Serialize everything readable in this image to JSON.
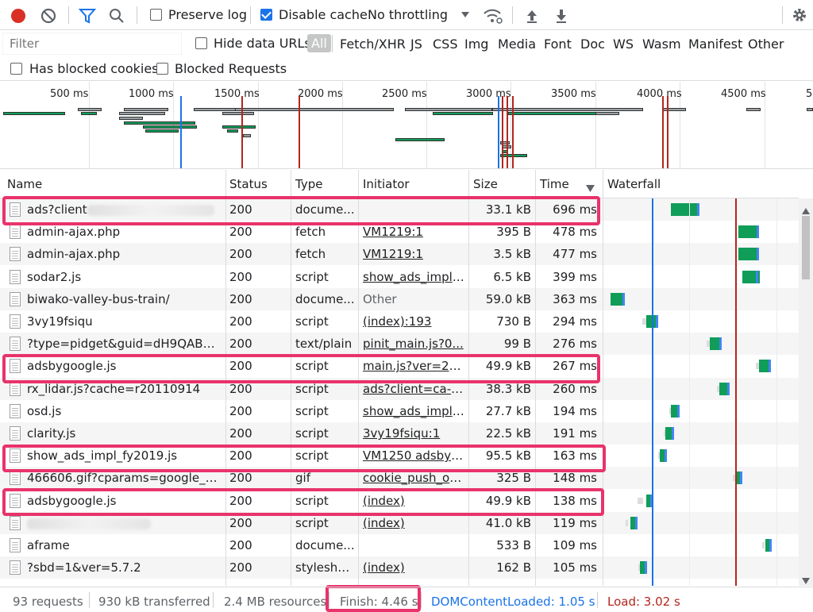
{
  "toolbar": {
    "preserve_log": "Preserve log",
    "disable_cache": "Disable cache",
    "throttling": "No throttling"
  },
  "filter": {
    "placeholder": "Filter",
    "hide_data_urls": "Hide data URLs",
    "types": [
      "All",
      "Fetch/XHR",
      "JS",
      "CSS",
      "Img",
      "Media",
      "Font",
      "Doc",
      "WS",
      "Wasm",
      "Manifest",
      "Other"
    ],
    "has_blocked_cookies": "Has blocked cookies",
    "blocked_requests": "Blocked Requests"
  },
  "overview": {
    "ticks": [
      "500 ms",
      "1000 ms",
      "1500 ms",
      "2000 ms",
      "2500 ms",
      "3000 ms",
      "3500 ms",
      "4000 ms",
      "4500 ms",
      "5"
    ]
  },
  "table": {
    "headers": {
      "name": "Name",
      "status": "Status",
      "type": "Type",
      "initiator": "Initiator",
      "size": "Size",
      "time": "Time",
      "waterfall": "Waterfall"
    },
    "rows": [
      {
        "name": "ads?client",
        "status": "200",
        "type": "docume...",
        "initiator": "",
        "size": "33.1 kB",
        "time": "696 ms"
      },
      {
        "name": "admin-ajax.php",
        "status": "200",
        "type": "fetch",
        "initiator": "VM1219:1",
        "size": "395 B",
        "time": "478 ms"
      },
      {
        "name": "admin-ajax.php",
        "status": "200",
        "type": "fetch",
        "initiator": "VM1219:1",
        "size": "3.5 kB",
        "time": "477 ms"
      },
      {
        "name": "sodar2.js",
        "status": "200",
        "type": "script",
        "initiator": "show_ads_impl_...",
        "size": "6.5 kB",
        "time": "399 ms"
      },
      {
        "name": "biwako-valley-bus-train/",
        "status": "200",
        "type": "docume...",
        "initiator": "Other",
        "size": "59.0 kB",
        "time": "363 ms"
      },
      {
        "name": "3vy19fsiqu",
        "status": "200",
        "type": "script",
        "initiator": "(index):193",
        "size": "730 B",
        "time": "294 ms"
      },
      {
        "name": "?type=pidget&guid=dH9QABH...",
        "status": "200",
        "type": "text/plain",
        "initiator": "pinit_main.js?0...",
        "size": "99 B",
        "time": "276 ms"
      },
      {
        "name": "adsbygoogle.js",
        "status": "200",
        "type": "script",
        "initiator": "main.js?ver=2.4....",
        "size": "49.9 kB",
        "time": "267 ms"
      },
      {
        "name": "rx_lidar.js?cache=r20110914",
        "status": "200",
        "type": "script",
        "initiator": "ads?client=ca-p...",
        "size": "38.3 kB",
        "time": "260 ms"
      },
      {
        "name": "osd.js",
        "status": "200",
        "type": "script",
        "initiator": "show_ads_impl_...",
        "size": "27.7 kB",
        "time": "194 ms"
      },
      {
        "name": "clarity.js",
        "status": "200",
        "type": "script",
        "initiator": "3vy19fsiqu:1",
        "size": "22.5 kB",
        "time": "191 ms"
      },
      {
        "name": "show_ads_impl_fy2019.js",
        "status": "200",
        "type": "script",
        "initiator": "VM1250 adsbyg...",
        "size": "95.5 kB",
        "time": "163 ms"
      },
      {
        "name": "466606.gif?cparams=google_pu...",
        "status": "200",
        "type": "gif",
        "initiator": "cookie_push_on...",
        "size": "325 B",
        "time": "148 ms"
      },
      {
        "name": "adsbygoogle.js",
        "status": "200",
        "type": "script",
        "initiator": "(index)",
        "size": "49.9 kB",
        "time": "138 ms"
      },
      {
        "name": "",
        "status": "200",
        "type": "script",
        "initiator": "(index)",
        "size": "41.0 kB",
        "time": "119 ms"
      },
      {
        "name": "aframe",
        "status": "200",
        "type": "docume...",
        "initiator": "",
        "size": "533 B",
        "time": "109 ms"
      },
      {
        "name": "?sbd=1&ver=5.7.2",
        "status": "200",
        "type": "stylesheet",
        "initiator": "(index)",
        "size": "162 B",
        "time": "105 ms"
      }
    ]
  },
  "status": {
    "requests": "93 requests",
    "transferred": "930 kB transferred",
    "resources": "2.4 MB resources",
    "finish": "Finish: 4.46 s",
    "dom_content_loaded": "DOMContentLoaded: 1.05 s",
    "load": "Load: 3.02 s"
  },
  "colors": {
    "record": "#d93025",
    "accent": "#1a73e8",
    "dcl_line": "#1a73e8",
    "load_line": "#b3261e",
    "highlight": "#e8336b",
    "bar_green": "#0f9d58"
  }
}
